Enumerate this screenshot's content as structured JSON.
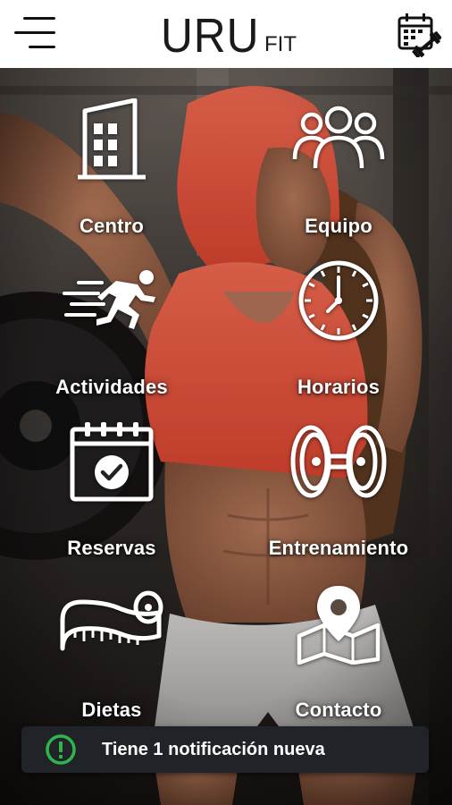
{
  "header": {
    "menu_icon": "hamburger-menu-icon",
    "logo_main": "URU",
    "logo_sub": "FIT",
    "calendar_icon": "calendar-dumbbell-icon"
  },
  "tiles": [
    {
      "label": "Centro",
      "icon": "building-icon"
    },
    {
      "label": "Equipo",
      "icon": "team-icon"
    },
    {
      "label": "Actividades",
      "icon": "running-person-icon"
    },
    {
      "label": "Horarios",
      "icon": "clock-icon"
    },
    {
      "label": "Reservas",
      "icon": "calendar-check-icon"
    },
    {
      "label": "Entrenamiento",
      "icon": "dumbbell-icon"
    },
    {
      "label": "Dietas",
      "icon": "measuring-tape-icon"
    },
    {
      "label": "Contacto",
      "icon": "map-pin-icon"
    }
  ],
  "notification": {
    "text": "Tiene 1 notificación nueva",
    "icon": "alert-icon",
    "accent_color": "#2fb54a"
  },
  "colors": {
    "header_bg": "#ffffff",
    "hoodie": "#f1553f"
  }
}
